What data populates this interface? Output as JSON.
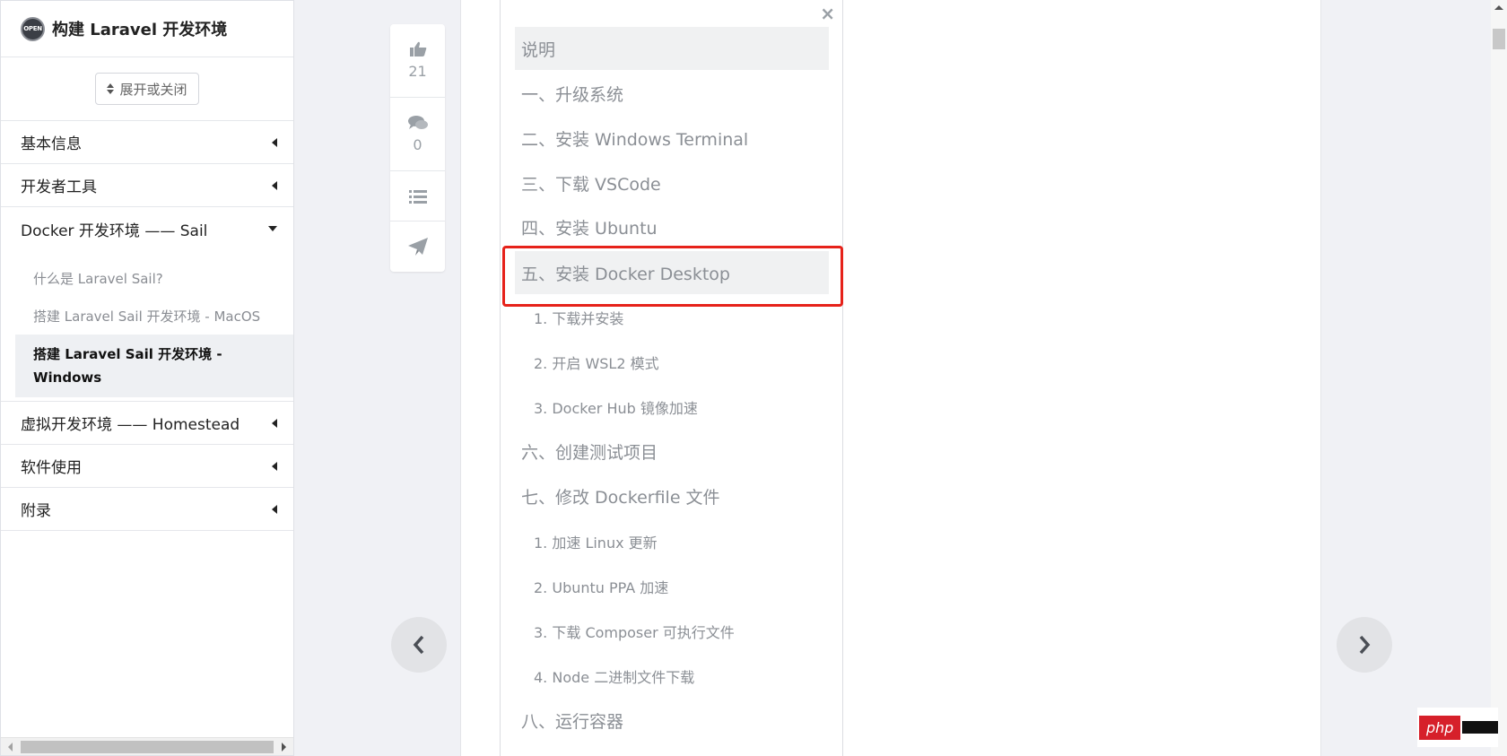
{
  "sidebar": {
    "logo_text": "OPEN",
    "title": "构建 Laravel 开发环境",
    "toggle_label": "展开或关闭",
    "items": [
      {
        "label": "基本信息"
      },
      {
        "label": "开发者工具"
      },
      {
        "label": "Docker 开发环境 —— Sail"
      },
      {
        "label": "虚拟开发环境 —— Homestead"
      },
      {
        "label": "软件使用"
      },
      {
        "label": "附录"
      }
    ],
    "sub_items": [
      {
        "label": "什么是 Laravel Sail?"
      },
      {
        "label": "搭建 Laravel Sail 开发环境 - MacOS"
      },
      {
        "label": "搭建 Laravel Sail 开发环境 - Windows"
      }
    ]
  },
  "actions": {
    "likes": "21",
    "comments": "0"
  },
  "toc": {
    "close": "×",
    "items": [
      {
        "label": "说明"
      },
      {
        "label": "一、升级系统"
      },
      {
        "label": "二、安装 Windows Terminal"
      },
      {
        "label": "三、下载 VSCode"
      },
      {
        "label": "四、安装 Ubuntu"
      },
      {
        "label": "五、安装 Docker Desktop"
      },
      {
        "label": "1. 下载并安装"
      },
      {
        "label": "2. 开启 WSL2 模式"
      },
      {
        "label": "3. Docker Hub 镜像加速"
      },
      {
        "label": "六、创建测试项目"
      },
      {
        "label": "七、修改 Dockerfile 文件"
      },
      {
        "label": "1. 加速 Linux 更新"
      },
      {
        "label": "2. Ubuntu PPA 加速"
      },
      {
        "label": "3. 下载 Composer 可执行文件"
      },
      {
        "label": "4. Node 二进制文件下载"
      },
      {
        "label": "八、运行容器"
      }
    ]
  },
  "watermark": {
    "text": "php"
  },
  "colors": {
    "highlight": "#e6221a",
    "muted_text": "#8b8f95"
  }
}
